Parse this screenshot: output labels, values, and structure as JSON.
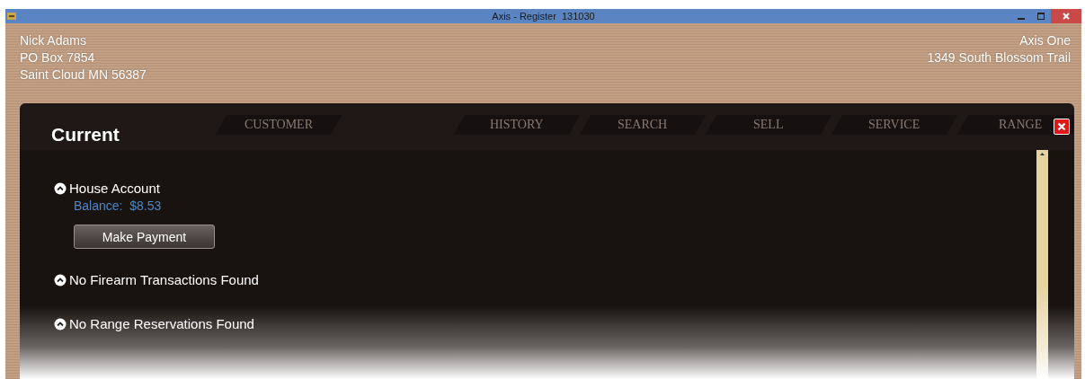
{
  "window": {
    "title": "Axis - Register  131030"
  },
  "customer": {
    "lines": [
      "Nick Adams",
      "PO Box 7854",
      "Saint Cloud MN 56387"
    ]
  },
  "store": {
    "lines": [
      "Axis One",
      "1349 South Blossom Trail"
    ]
  },
  "background_tabs": [
    {
      "label": "CUSTOMER"
    },
    {
      "label": "HISTORY"
    },
    {
      "label": "SEARCH"
    },
    {
      "label": "SELL"
    },
    {
      "label": "SERVICE"
    },
    {
      "label": "RANGE"
    }
  ],
  "dialog": {
    "title": "Current",
    "sections": [
      {
        "title": "House Account",
        "balance": "Balance:  $8.53",
        "button": "Make Payment"
      },
      {
        "title": "No Firearm Transactions Found"
      },
      {
        "title": "No Range Reservations Found"
      }
    ]
  }
}
